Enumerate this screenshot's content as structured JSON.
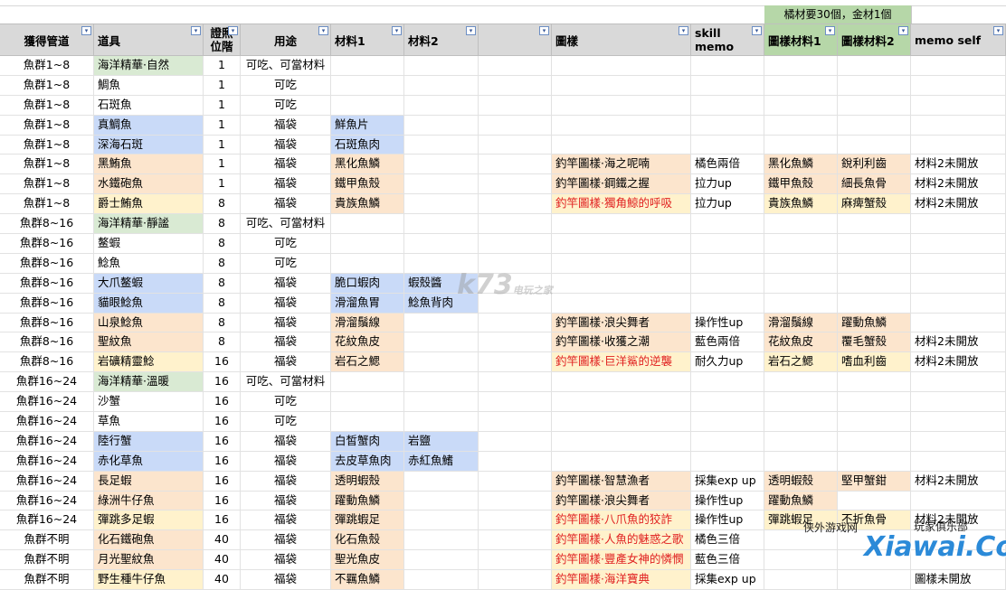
{
  "note": "橘材要30個，金材1個",
  "headers": [
    "獲得管道",
    "道具",
    "證照位階",
    "用途",
    "材料1",
    "材料2",
    "",
    "圖樣",
    "skill memo",
    "圖樣材料1",
    "圖樣材料2",
    "memo self"
  ],
  "rows": [
    [
      "魚群1~8",
      "海洋精華·自然",
      "1",
      "可吃、可當材料",
      "",
      "",
      "",
      "",
      "",
      "",
      "",
      ""
    ],
    [
      "魚群1~8",
      "鯛魚",
      "1",
      "可吃",
      "",
      "",
      "",
      "",
      "",
      "",
      "",
      ""
    ],
    [
      "魚群1~8",
      "石斑魚",
      "1",
      "可吃",
      "",
      "",
      "",
      "",
      "",
      "",
      "",
      ""
    ],
    [
      "魚群1~8",
      "真鯛魚",
      "1",
      "福袋",
      "鮮魚片",
      "",
      "",
      "",
      "",
      "",
      "",
      ""
    ],
    [
      "魚群1~8",
      "深海石斑",
      "1",
      "福袋",
      "石斑魚肉",
      "",
      "",
      "",
      "",
      "",
      "",
      ""
    ],
    [
      "魚群1~8",
      "黑鮪魚",
      "1",
      "福袋",
      "黑化魚鱗",
      "",
      "",
      "釣竿圖樣·海之呢喃",
      "橘色兩倍",
      "黑化魚鱗",
      "銳利利齒",
      "材料2未開放"
    ],
    [
      "魚群1~8",
      "水鐵砲魚",
      "1",
      "福袋",
      "鐵甲魚殼",
      "",
      "",
      "釣竿圖樣·鋼鐵之握",
      "拉力up",
      "鐵甲魚殼",
      "細長魚骨",
      "材料2未開放"
    ],
    [
      "魚群1~8",
      "爵士鮪魚",
      "8",
      "福袋",
      "貴族魚鱗",
      "",
      "",
      "釣竿圖樣·獨角鯨的呼吸",
      "拉力up",
      "貴族魚鱗",
      "麻痺蟹殼",
      "材料2未開放"
    ],
    [
      "魚群8~16",
      "海洋精華·靜謐",
      "8",
      "可吃、可當材料",
      "",
      "",
      "",
      "",
      "",
      "",
      "",
      ""
    ],
    [
      "魚群8~16",
      "鳌蝦",
      "8",
      "可吃",
      "",
      "",
      "",
      "",
      "",
      "",
      "",
      ""
    ],
    [
      "魚群8~16",
      "鯰魚",
      "8",
      "可吃",
      "",
      "",
      "",
      "",
      "",
      "",
      "",
      ""
    ],
    [
      "魚群8~16",
      "大爪鳌蝦",
      "8",
      "福袋",
      "脆口蝦肉",
      "蝦殼醬",
      "",
      "",
      "",
      "",
      "",
      ""
    ],
    [
      "魚群8~16",
      "貓眼鯰魚",
      "8",
      "福袋",
      "滑溜魚胃",
      "鯰魚背肉",
      "",
      "",
      "",
      "",
      "",
      ""
    ],
    [
      "魚群8~16",
      "山泉鯰魚",
      "8",
      "福袋",
      "滑溜鬚線",
      "",
      "",
      "釣竿圖樣·浪尖舞者",
      "操作性up",
      "滑溜鬚線",
      "躍動魚鱗",
      ""
    ],
    [
      "魚群8~16",
      "聖紋魚",
      "8",
      "福袋",
      "花紋魚皮",
      "",
      "",
      "釣竿圖樣·收獲之潮",
      "藍色兩倍",
      "花紋魚皮",
      "覆毛蟹殼",
      "材料2未開放"
    ],
    [
      "魚群8~16",
      "岩礦精靈鯰",
      "16",
      "福袋",
      "岩石之鰓",
      "",
      "",
      "釣竿圖樣·巨洋鯊的逆襲",
      "耐久力up",
      "岩石之鰓",
      "嗜血利齒",
      "材料2未開放"
    ],
    [
      "魚群16~24",
      "海洋精華·溫暖",
      "16",
      "可吃、可當材料",
      "",
      "",
      "",
      "",
      "",
      "",
      "",
      ""
    ],
    [
      "魚群16~24",
      "沙蟹",
      "16",
      "可吃",
      "",
      "",
      "",
      "",
      "",
      "",
      "",
      ""
    ],
    [
      "魚群16~24",
      "草魚",
      "16",
      "可吃",
      "",
      "",
      "",
      "",
      "",
      "",
      "",
      ""
    ],
    [
      "魚群16~24",
      "陸行蟹",
      "16",
      "福袋",
      "白皙蟹肉",
      "岩鹽",
      "",
      "",
      "",
      "",
      "",
      ""
    ],
    [
      "魚群16~24",
      "赤化草魚",
      "16",
      "福袋",
      "去皮草魚肉",
      "赤紅魚鰭",
      "",
      "",
      "",
      "",
      "",
      ""
    ],
    [
      "魚群16~24",
      "長足蝦",
      "16",
      "福袋",
      "透明蝦殼",
      "",
      "",
      "釣竿圖樣·智慧漁者",
      "採集exp up",
      "透明蝦殼",
      "堅甲蟹鉗",
      "材料2未開放"
    ],
    [
      "魚群16~24",
      "綠洲牛仔魚",
      "16",
      "福袋",
      "躍動魚鱗",
      "",
      "",
      "釣竿圖樣·浪尖舞者",
      "操作性up",
      "躍動魚鱗",
      "",
      ""
    ],
    [
      "魚群16~24",
      "彈跳多足蝦",
      "16",
      "福袋",
      "彈跳蝦足",
      "",
      "",
      "釣竿圖樣·八爪魚的狡詐",
      "操作性up",
      "彈跳蝦足",
      "不折魚骨",
      "材料2未開放"
    ],
    [
      "魚群不明",
      "化石鐵砲魚",
      "40",
      "福袋",
      "化石魚殼",
      "",
      "",
      "釣竿圖樣·人魚的魅惑之歌",
      "橘色三倍",
      "",
      "",
      ""
    ],
    [
      "魚群不明",
      "月光聖紋魚",
      "40",
      "福袋",
      "聖光魚皮",
      "",
      "",
      "釣竿圖樣·豐產女神的憐憫",
      "藍色三倍",
      "",
      "",
      ""
    ],
    [
      "魚群不明",
      "野生種牛仔魚",
      "40",
      "福袋",
      "不羈魚鱗",
      "",
      "",
      "釣竿圖樣·海洋寶典",
      "採集exp up",
      "",
      "",
      "圖樣未開放"
    ]
  ],
  "watermarks": {
    "k73": "k73",
    "k73_sub": "电玩之家",
    "xiawai_cn": "侠外游戏网",
    "xiawai": "Xiawai.Com",
    "club": "玩家俱乐部"
  },
  "colors": {
    "green": "#d9ead3",
    "blue": "#c9daf8",
    "peach": "#fce5cd",
    "yellow": "#fff2cc",
    "header": "#d9d9d9",
    "header_green": "#b6d7a8",
    "red_text": "#e02020"
  }
}
